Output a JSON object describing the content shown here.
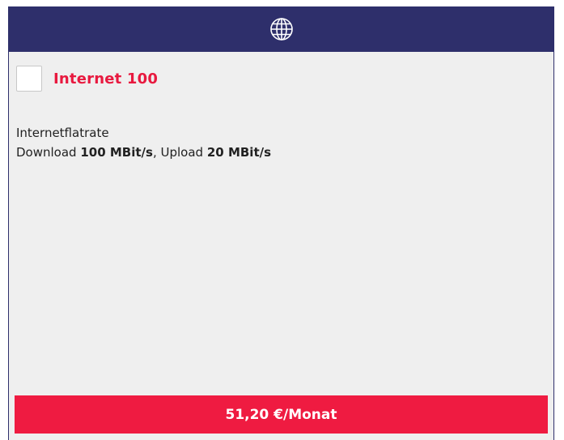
{
  "header": {
    "icon": "globe-icon"
  },
  "product": {
    "name": "Internet 100",
    "checked": false
  },
  "description": {
    "line1": "Internetflatrate",
    "download_label": "Download ",
    "download_value": "100 MBit/s",
    "separator": ", Upload ",
    "upload_value": "20 MBit/s"
  },
  "price": {
    "label": "51,20 €/Monat"
  },
  "colors": {
    "header": "#2e2f6b",
    "accent": "#ef1b41",
    "card_background": "#efefef"
  }
}
